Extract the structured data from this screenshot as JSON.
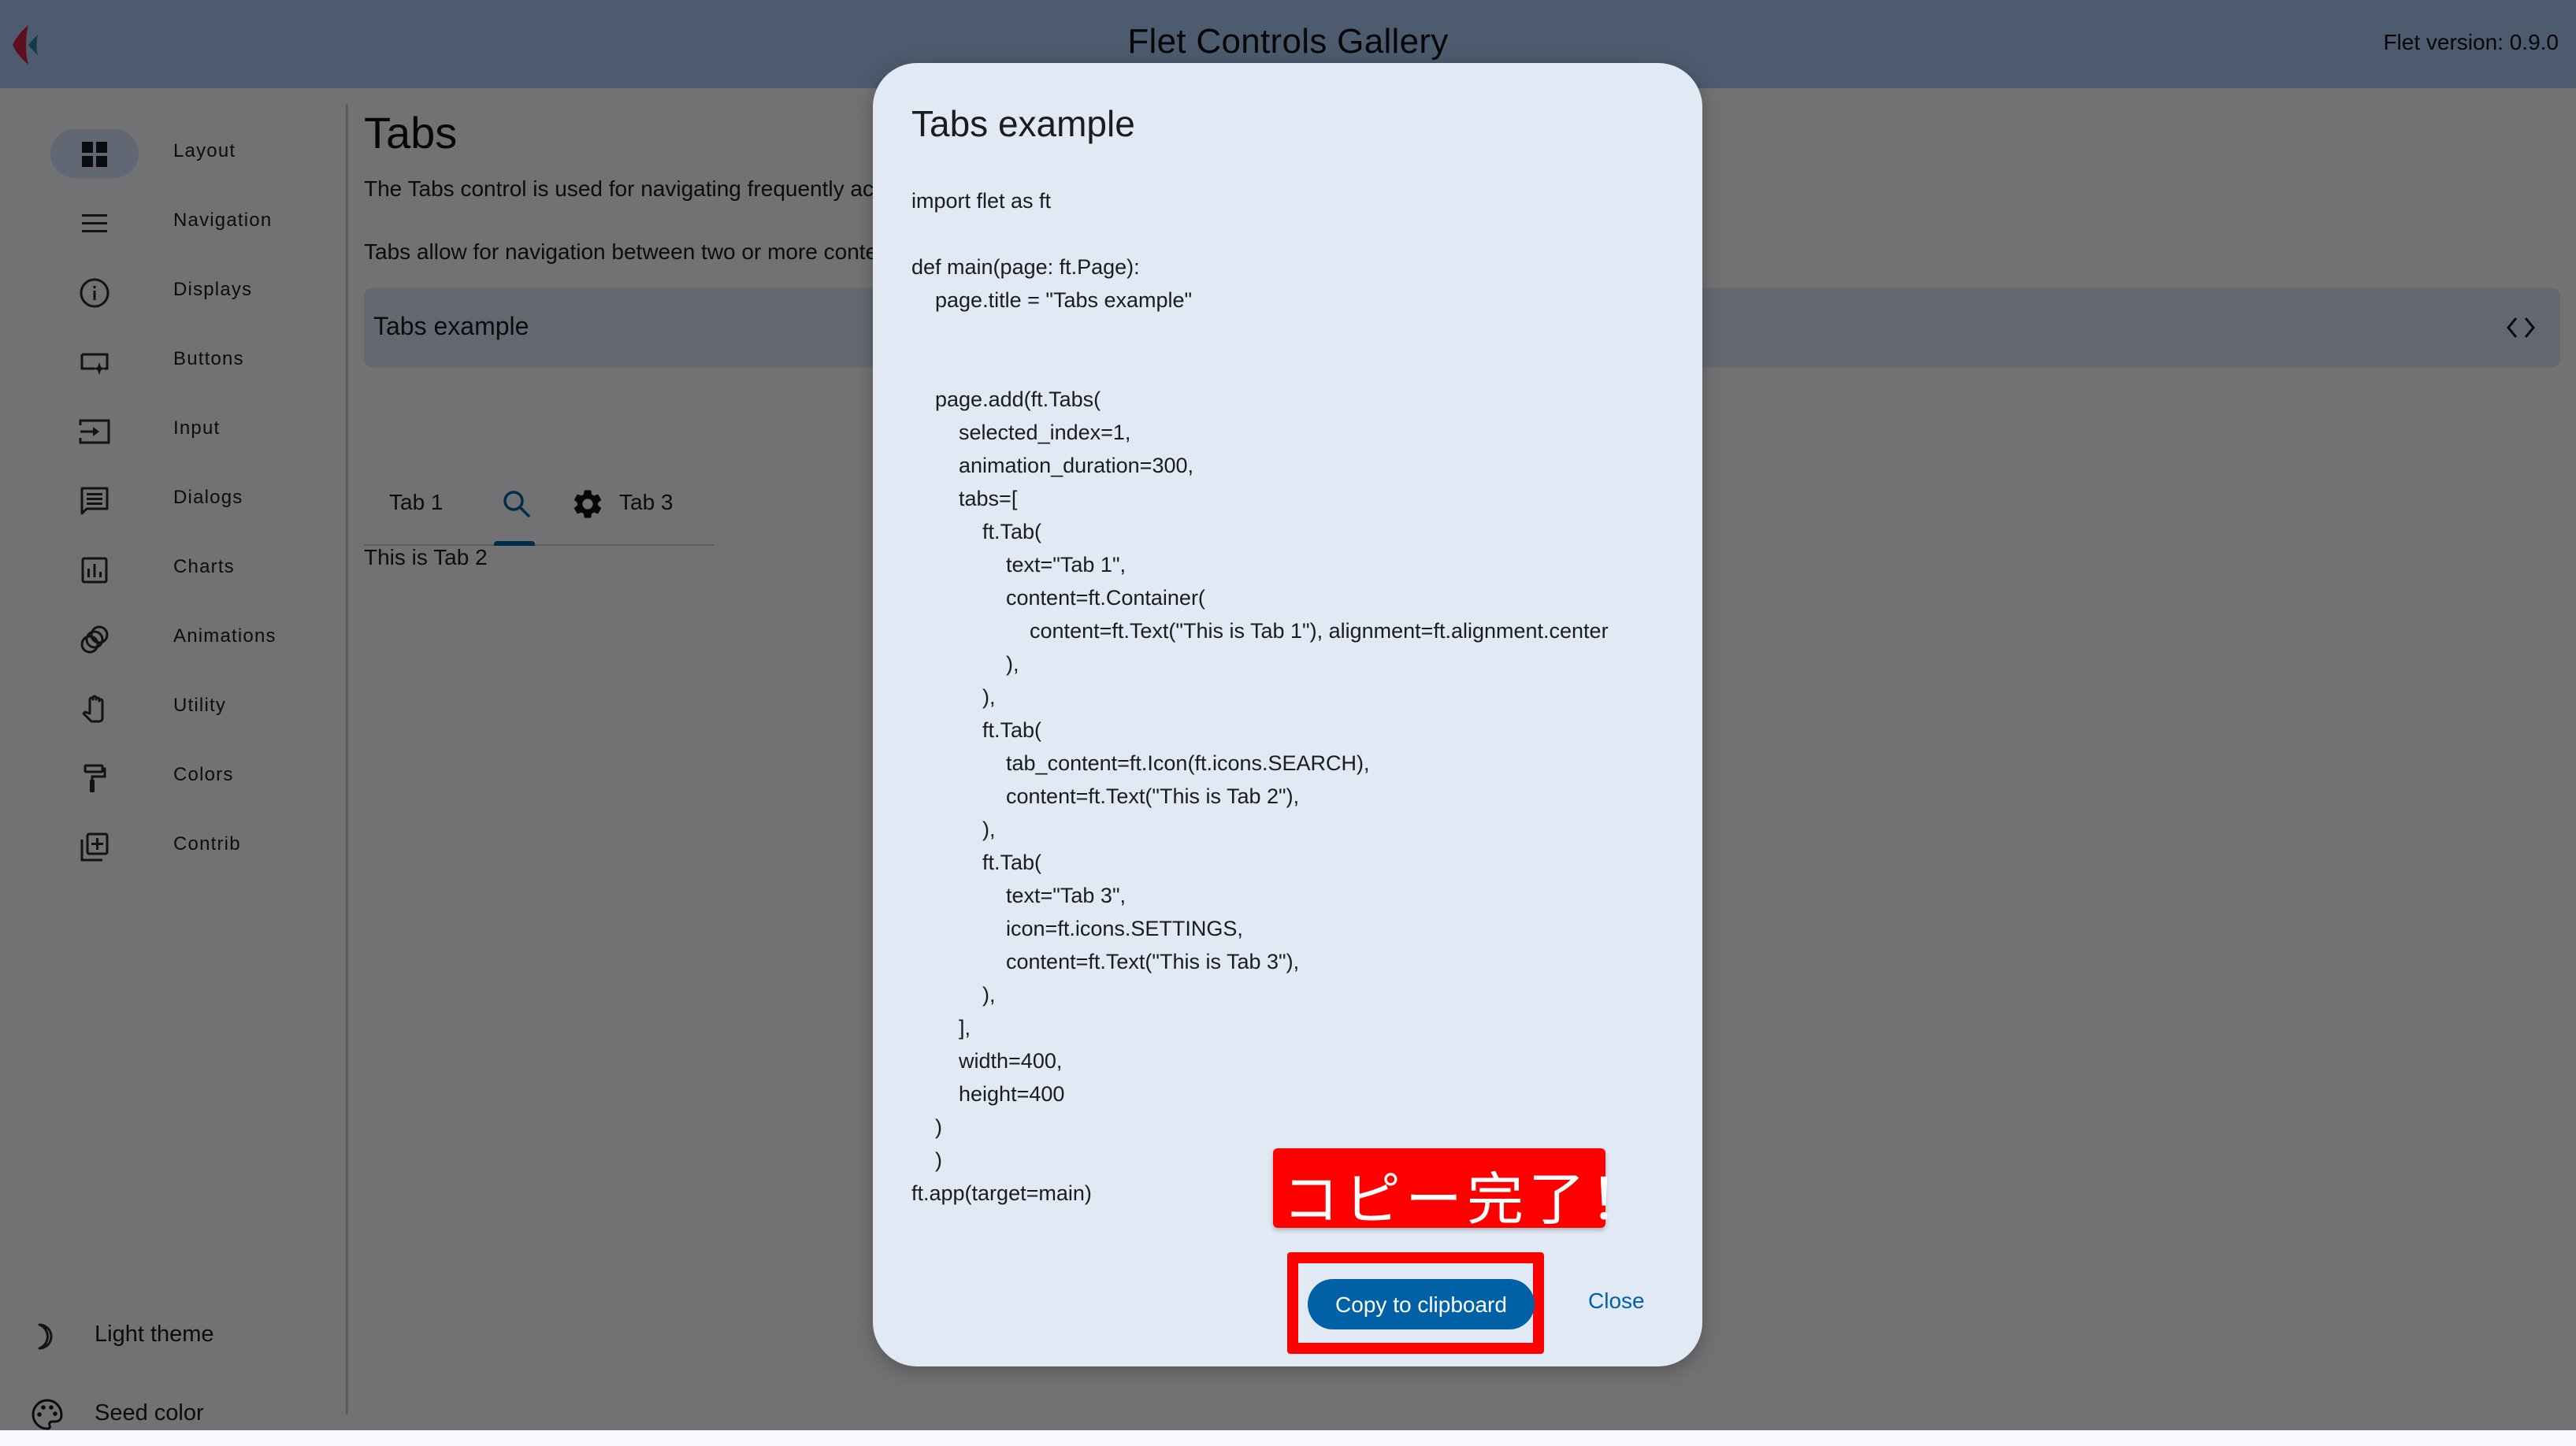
{
  "appbar": {
    "title": "Flet Controls Gallery",
    "version": "Flet version: 0.9.0",
    "logo": "flet-logo-icon"
  },
  "sidebar": {
    "items": [
      {
        "label": "Layout",
        "icon": "grid-view-icon",
        "selected": true
      },
      {
        "label": "Navigation",
        "icon": "menu-icon",
        "selected": false
      },
      {
        "label": "Displays",
        "icon": "info-icon",
        "selected": false
      },
      {
        "label": "Buttons",
        "icon": "smart-button-icon",
        "selected": false
      },
      {
        "label": "Input",
        "icon": "input-icon",
        "selected": false
      },
      {
        "label": "Dialogs",
        "icon": "chat-icon",
        "selected": false
      },
      {
        "label": "Charts",
        "icon": "bar-chart-icon",
        "selected": false
      },
      {
        "label": "Animations",
        "icon": "animation-icon",
        "selected": false
      },
      {
        "label": "Utility",
        "icon": "hand-icon",
        "selected": false
      },
      {
        "label": "Colors",
        "icon": "format-paint-icon",
        "selected": false
      },
      {
        "label": "Contrib",
        "icon": "library-add-icon",
        "selected": false
      }
    ],
    "bottom": [
      {
        "label": "Light theme",
        "icon": "moon-icon"
      },
      {
        "label": "Seed color",
        "icon": "palette-icon"
      }
    ]
  },
  "main": {
    "title": "Tabs",
    "description_1": "The Tabs control is used for navigating frequently accessed, distinct content categories.",
    "description_2": "Tabs allow for navigation between two or more content views and relies on text headers to articulate the different sections of content.",
    "example_title": "Tabs example",
    "tabs": [
      {
        "label": "Tab 1",
        "icon": null
      },
      {
        "label": "",
        "icon": "search-icon",
        "selected": true
      },
      {
        "label": "Tab 3",
        "icon": "settings-icon"
      }
    ],
    "tab_content": "This is Tab 2"
  },
  "dialog": {
    "title": "Tabs example",
    "code_lines": [
      "import flet as ft",
      "",
      "def main(page: ft.Page):",
      "    page.title = \"Tabs example\"",
      "",
      "",
      "    page.add(ft.Tabs(",
      "        selected_index=1,",
      "        animation_duration=300,",
      "        tabs=[",
      "            ft.Tab(",
      "                text=\"Tab 1\",",
      "                content=ft.Container(",
      "                    content=ft.Text(\"This is Tab 1\"), alignment=ft.alignment.center",
      "                ),",
      "            ),",
      "            ft.Tab(",
      "                tab_content=ft.Icon(ft.icons.SEARCH),",
      "                content=ft.Text(\"This is Tab 2\"),",
      "            ),",
      "            ft.Tab(",
      "                text=\"Tab 3\",",
      "                icon=ft.icons.SETTINGS,",
      "                content=ft.Text(\"This is Tab 3\"),",
      "            ),",
      "        ],",
      "        width=400,",
      "        height=400",
      "    )",
      "    )",
      "ft.app(target=main)"
    ],
    "copy_label": "Copy to clipboard",
    "close_label": "Close",
    "toast": "コピー完了！"
  },
  "colors": {
    "appbar": "#a9c7ef",
    "primary": "#0061a6",
    "annotation_red": "#ff0000",
    "dialog_bg": "#e1e9f5"
  }
}
